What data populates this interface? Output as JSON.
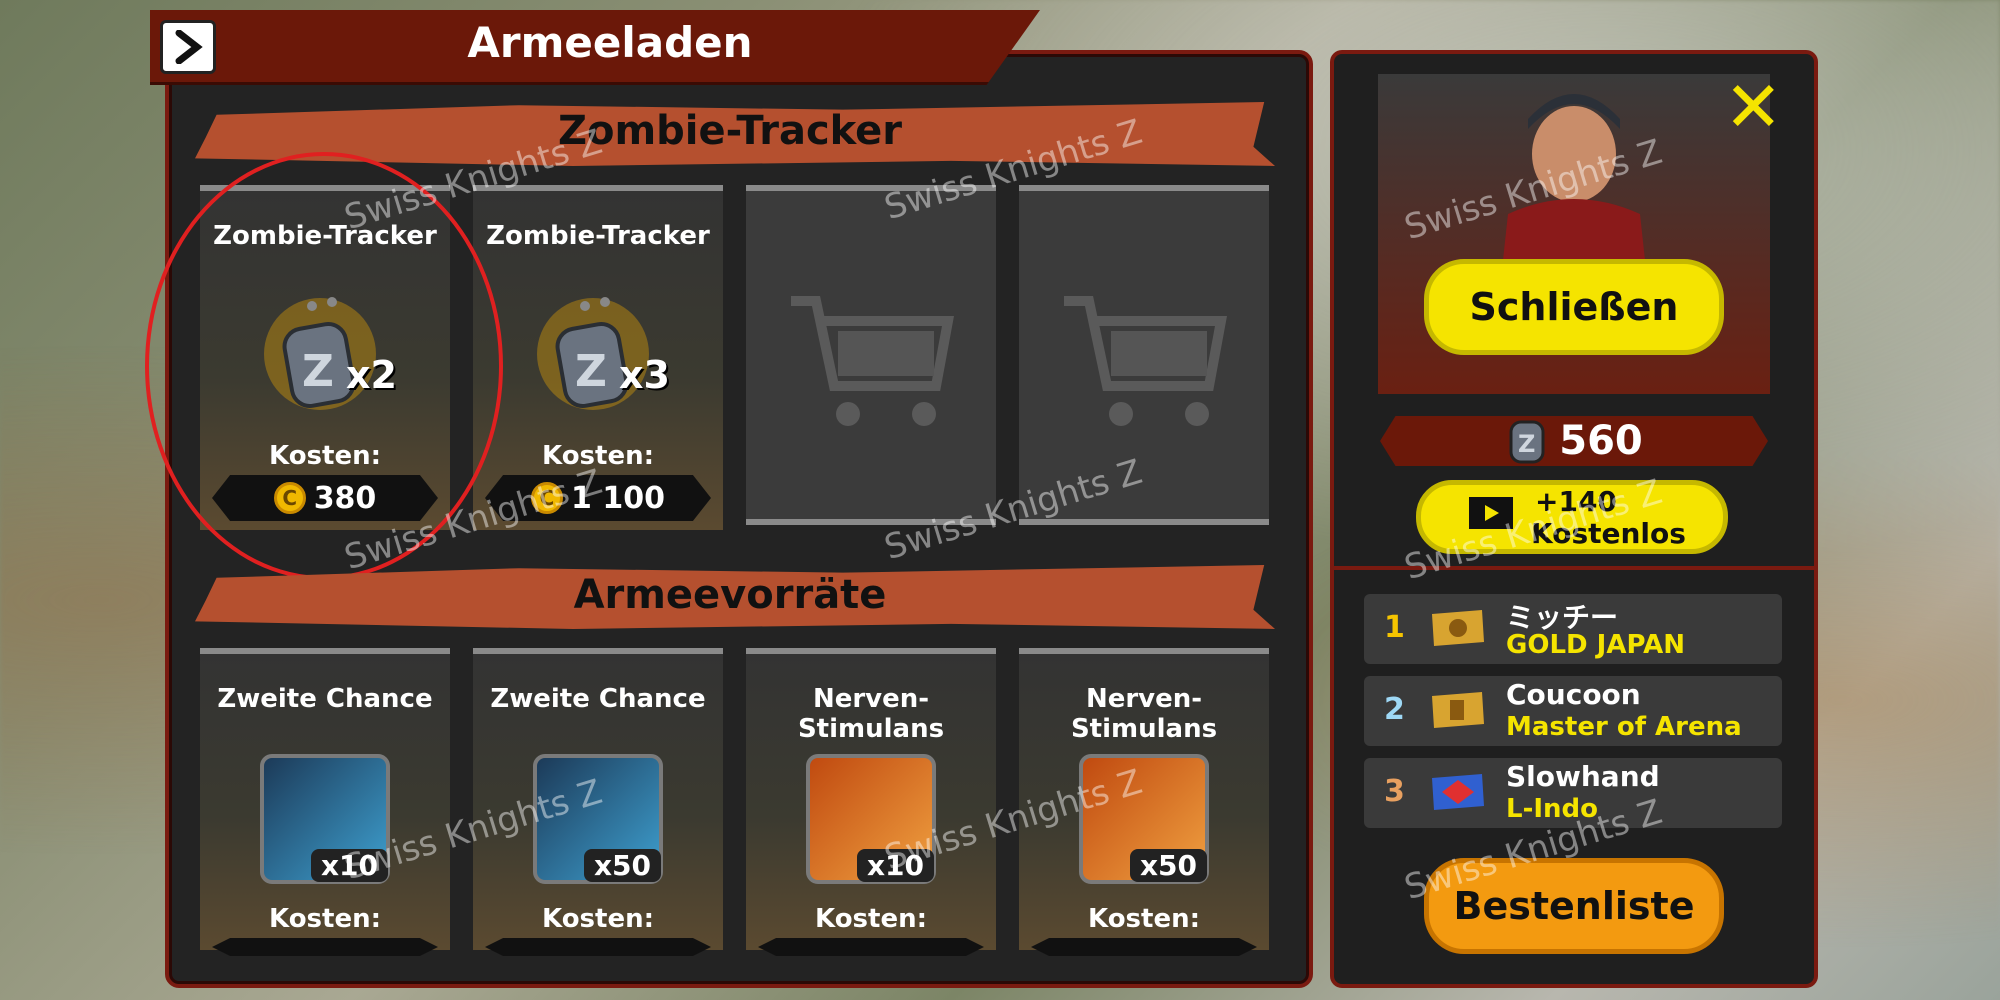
{
  "header": {
    "title": "Armeeladen"
  },
  "sections": {
    "tracker": {
      "title": "Zombie-Tracker"
    },
    "supplies": {
      "title": "Armeevorräte"
    }
  },
  "tracker_items": [
    {
      "name": "Zombie-Tracker",
      "qty": "x2",
      "cost_label": "Kosten:",
      "price": "380"
    },
    {
      "name": "Zombie-Tracker",
      "qty": "x3",
      "cost_label": "Kosten:",
      "price": "1 100"
    }
  ],
  "supply_items": [
    {
      "name": "Zweite Chance",
      "qty": "x10",
      "cost_label": "Kosten:"
    },
    {
      "name": "Zweite Chance",
      "qty": "x50",
      "cost_label": "Kosten:"
    },
    {
      "name": "Nerven-Stimulans",
      "qty": "x10",
      "cost_label": "Kosten:"
    },
    {
      "name": "Nerven-Stimulans",
      "qty": "x50",
      "cost_label": "Kosten:"
    }
  ],
  "side": {
    "close_label": "Schließen",
    "tag_count": "560",
    "free_bonus": "+140",
    "free_label": "Kostenlos",
    "leaderboard_label": "Bestenliste",
    "ranks": [
      {
        "rank": "1",
        "name": "ミッチー",
        "guild": "GOLD JAPAN"
      },
      {
        "rank": "2",
        "name": "Coucoon",
        "guild": "Master of Arena"
      },
      {
        "rank": "3",
        "name": "Slowhand",
        "guild": "L-Indo"
      }
    ]
  },
  "watermark": "Swiss Knights Z",
  "colors": {
    "panel_border": "#7a1a10",
    "accent_yellow": "#f5e400",
    "accent_orange": "#f39a10",
    "section_band": "#b5502f"
  }
}
